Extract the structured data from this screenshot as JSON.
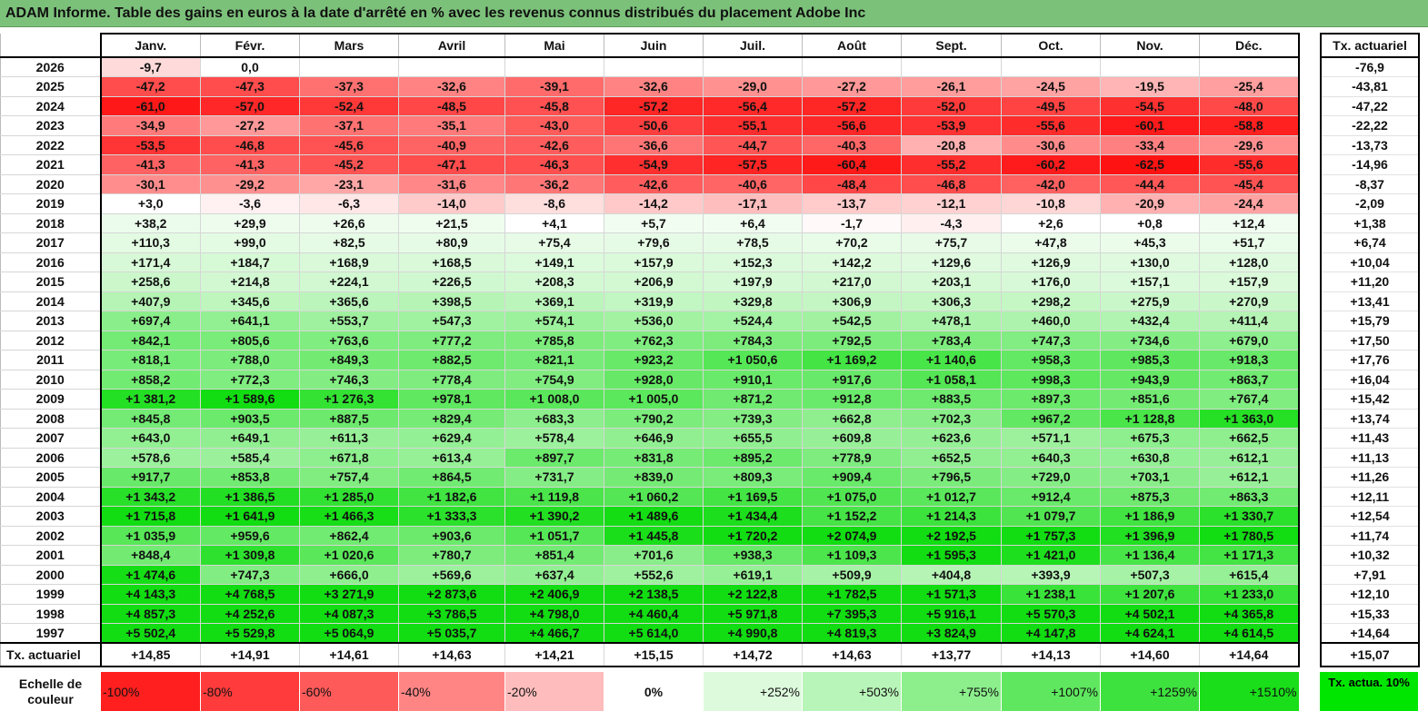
{
  "title": "ADAM Informe. Table des gains en euros à la date d'arrêté en % avec les revenus connus distribués du placement Adobe Inc",
  "months": [
    "Janv.",
    "Févr.",
    "Mars",
    "Avril",
    "Mai",
    "Juin",
    "Juil.",
    "Août",
    "Sept.",
    "Oct.",
    "Nov.",
    "Déc."
  ],
  "side_header": "Tx. actuariel",
  "rows": [
    {
      "year": "2026",
      "cells": [
        "-9,7",
        "0,0",
        "",
        "",
        "",
        "",
        "",
        "",
        "",
        "",
        "",
        ""
      ],
      "rate": "-76,9"
    },
    {
      "year": "2025",
      "cells": [
        "-47,2",
        "-47,3",
        "-37,3",
        "-32,6",
        "-39,1",
        "-32,6",
        "-29,0",
        "-27,2",
        "-26,1",
        "-24,5",
        "-19,5",
        "-25,4"
      ],
      "rate": "-43,81"
    },
    {
      "year": "2024",
      "cells": [
        "-61,0",
        "-57,0",
        "-52,4",
        "-48,5",
        "-45,8",
        "-57,2",
        "-56,4",
        "-57,2",
        "-52,0",
        "-49,5",
        "-54,5",
        "-48,0"
      ],
      "rate": "-47,22"
    },
    {
      "year": "2023",
      "cells": [
        "-34,9",
        "-27,2",
        "-37,1",
        "-35,1",
        "-43,0",
        "-50,6",
        "-55,1",
        "-56,6",
        "-53,9",
        "-55,6",
        "-60,1",
        "-58,8"
      ],
      "rate": "-22,22"
    },
    {
      "year": "2022",
      "cells": [
        "-53,5",
        "-46,8",
        "-45,6",
        "-40,9",
        "-42,6",
        "-36,6",
        "-44,7",
        "-40,3",
        "-20,8",
        "-30,6",
        "-33,4",
        "-29,6"
      ],
      "rate": "-13,73"
    },
    {
      "year": "2021",
      "cells": [
        "-41,3",
        "-41,3",
        "-45,2",
        "-47,1",
        "-46,3",
        "-54,9",
        "-57,5",
        "-60,4",
        "-55,2",
        "-60,2",
        "-62,5",
        "-55,6"
      ],
      "rate": "-14,96"
    },
    {
      "year": "2020",
      "cells": [
        "-30,1",
        "-29,2",
        "-23,1",
        "-31,6",
        "-36,2",
        "-42,6",
        "-40,6",
        "-48,4",
        "-46,8",
        "-42,0",
        "-44,4",
        "-45,4"
      ],
      "rate": "-8,37"
    },
    {
      "year": "2019",
      "cells": [
        "+3,0",
        "-3,6",
        "-6,3",
        "-14,0",
        "-8,6",
        "-14,2",
        "-17,1",
        "-13,7",
        "-12,1",
        "-10,8",
        "-20,9",
        "-24,4"
      ],
      "rate": "-2,09"
    },
    {
      "year": "2018",
      "cells": [
        "+38,2",
        "+29,9",
        "+26,6",
        "+21,5",
        "+4,1",
        "+5,7",
        "+6,4",
        "-1,7",
        "-4,3",
        "+2,6",
        "+0,8",
        "+12,4"
      ],
      "rate": "+1,38"
    },
    {
      "year": "2017",
      "cells": [
        "+110,3",
        "+99,0",
        "+82,5",
        "+80,9",
        "+75,4",
        "+79,6",
        "+78,5",
        "+70,2",
        "+75,7",
        "+47,8",
        "+45,3",
        "+51,7"
      ],
      "rate": "+6,74"
    },
    {
      "year": "2016",
      "cells": [
        "+171,4",
        "+184,7",
        "+168,9",
        "+168,5",
        "+149,1",
        "+157,9",
        "+152,3",
        "+142,2",
        "+129,6",
        "+126,9",
        "+130,0",
        "+128,0"
      ],
      "rate": "+10,04"
    },
    {
      "year": "2015",
      "cells": [
        "+258,6",
        "+214,8",
        "+224,1",
        "+226,5",
        "+208,3",
        "+206,9",
        "+197,9",
        "+217,0",
        "+203,1",
        "+176,0",
        "+157,1",
        "+157,9"
      ],
      "rate": "+11,20"
    },
    {
      "year": "2014",
      "cells": [
        "+407,9",
        "+345,6",
        "+365,6",
        "+398,5",
        "+369,1",
        "+319,9",
        "+329,8",
        "+306,9",
        "+306,3",
        "+298,2",
        "+275,9",
        "+270,9"
      ],
      "rate": "+13,41"
    },
    {
      "year": "2013",
      "cells": [
        "+697,4",
        "+641,1",
        "+553,7",
        "+547,3",
        "+574,1",
        "+536,0",
        "+524,4",
        "+542,5",
        "+478,1",
        "+460,0",
        "+432,4",
        "+411,4"
      ],
      "rate": "+15,79"
    },
    {
      "year": "2012",
      "cells": [
        "+842,1",
        "+805,6",
        "+763,6",
        "+777,2",
        "+785,8",
        "+762,3",
        "+784,3",
        "+792,5",
        "+783,4",
        "+747,3",
        "+734,6",
        "+679,0"
      ],
      "rate": "+17,50"
    },
    {
      "year": "2011",
      "cells": [
        "+818,1",
        "+788,0",
        "+849,3",
        "+882,5",
        "+821,1",
        "+923,2",
        "+1 050,6",
        "+1 169,2",
        "+1 140,6",
        "+958,3",
        "+985,3",
        "+918,3"
      ],
      "rate": "+17,76"
    },
    {
      "year": "2010",
      "cells": [
        "+858,2",
        "+772,3",
        "+746,3",
        "+778,4",
        "+754,9",
        "+928,0",
        "+910,1",
        "+917,6",
        "+1 058,1",
        "+998,3",
        "+943,9",
        "+863,7"
      ],
      "rate": "+16,04"
    },
    {
      "year": "2009",
      "cells": [
        "+1 381,2",
        "+1 589,6",
        "+1 276,3",
        "+978,1",
        "+1 008,0",
        "+1 005,0",
        "+871,2",
        "+912,8",
        "+883,5",
        "+897,3",
        "+851,6",
        "+767,4"
      ],
      "rate": "+15,42"
    },
    {
      "year": "2008",
      "cells": [
        "+845,8",
        "+903,5",
        "+887,5",
        "+829,4",
        "+683,3",
        "+790,2",
        "+739,3",
        "+662,8",
        "+702,3",
        "+967,2",
        "+1 128,8",
        "+1 363,0"
      ],
      "rate": "+13,74"
    },
    {
      "year": "2007",
      "cells": [
        "+643,0",
        "+649,1",
        "+611,3",
        "+629,4",
        "+578,4",
        "+646,9",
        "+655,5",
        "+609,8",
        "+623,6",
        "+571,1",
        "+675,3",
        "+662,5"
      ],
      "rate": "+11,43"
    },
    {
      "year": "2006",
      "cells": [
        "+578,6",
        "+585,4",
        "+671,8",
        "+613,4",
        "+897,7",
        "+831,8",
        "+895,2",
        "+778,9",
        "+652,5",
        "+640,3",
        "+630,8",
        "+612,1"
      ],
      "rate": "+11,13"
    },
    {
      "year": "2005",
      "cells": [
        "+917,7",
        "+853,8",
        "+757,4",
        "+864,5",
        "+731,7",
        "+839,0",
        "+809,3",
        "+909,4",
        "+796,5",
        "+729,0",
        "+703,1",
        "+612,1"
      ],
      "rate": "+11,26"
    },
    {
      "year": "2004",
      "cells": [
        "+1 343,2",
        "+1 386,5",
        "+1 285,0",
        "+1 182,6",
        "+1 119,8",
        "+1 060,2",
        "+1 169,5",
        "+1 075,0",
        "+1 012,7",
        "+912,4",
        "+875,3",
        "+863,3"
      ],
      "rate": "+12,11"
    },
    {
      "year": "2003",
      "cells": [
        "+1 715,8",
        "+1 641,9",
        "+1 466,3",
        "+1 333,3",
        "+1 390,2",
        "+1 489,6",
        "+1 434,4",
        "+1 152,2",
        "+1 214,3",
        "+1 079,7",
        "+1 186,9",
        "+1 330,7"
      ],
      "rate": "+12,54"
    },
    {
      "year": "2002",
      "cells": [
        "+1 035,9",
        "+959,6",
        "+862,4",
        "+903,6",
        "+1 051,7",
        "+1 445,8",
        "+1 720,2",
        "+2 074,9",
        "+2 192,5",
        "+1 757,3",
        "+1 396,9",
        "+1 780,5"
      ],
      "rate": "+11,74"
    },
    {
      "year": "2001",
      "cells": [
        "+848,4",
        "+1 309,8",
        "+1 020,6",
        "+780,7",
        "+851,4",
        "+701,6",
        "+938,3",
        "+1 109,3",
        "+1 595,3",
        "+1 421,0",
        "+1 136,4",
        "+1 171,3"
      ],
      "rate": "+10,32"
    },
    {
      "year": "2000",
      "cells": [
        "+1 474,6",
        "+747,3",
        "+666,0",
        "+569,6",
        "+637,4",
        "+552,6",
        "+619,1",
        "+509,9",
        "+404,8",
        "+393,9",
        "+507,3",
        "+615,4"
      ],
      "rate": "+7,91"
    },
    {
      "year": "1999",
      "cells": [
        "+4 143,3",
        "+4 768,5",
        "+3 271,9",
        "+2 873,6",
        "+2 406,9",
        "+2 138,5",
        "+2 122,8",
        "+1 782,5",
        "+1 571,3",
        "+1 238,1",
        "+1 207,6",
        "+1 233,0"
      ],
      "rate": "+12,10"
    },
    {
      "year": "1998",
      "cells": [
        "+4 857,3",
        "+4 252,6",
        "+4 087,3",
        "+3 786,5",
        "+4 798,0",
        "+4 460,4",
        "+5 971,8",
        "+7 395,3",
        "+5 916,1",
        "+5 570,3",
        "+4 502,1",
        "+4 365,8"
      ],
      "rate": "+15,33"
    },
    {
      "year": "1997",
      "cells": [
        "+5 502,4",
        "+5 529,8",
        "+5 064,9",
        "+5 035,7",
        "+4 466,7",
        "+5 614,0",
        "+4 990,8",
        "+4 819,3",
        "+3 824,9",
        "+4 147,8",
        "+4 624,1",
        "+4 614,5"
      ],
      "rate": "+14,64"
    }
  ],
  "average_row": {
    "label": "Tx. actuariel",
    "cells": [
      "+14,85",
      "+14,91",
      "+14,61",
      "+14,63",
      "+14,21",
      "+15,15",
      "+14,72",
      "+14,63",
      "+13,77",
      "+14,13",
      "+14,60",
      "+14,64"
    ],
    "rate": "+15,07"
  },
  "scale": {
    "label": "Echelle de couleur",
    "steps": [
      {
        "text": "-100%",
        "color": "#ff1f1f"
      },
      {
        "text": "-80%",
        "color": "#ff3b3b"
      },
      {
        "text": "-60%",
        "color": "#ff5a5a"
      },
      {
        "text": "-40%",
        "color": "#ff8585"
      },
      {
        "text": "-20%",
        "color": "#ffbcbc"
      },
      {
        "text": "0%",
        "color": "#ffffff"
      },
      {
        "text": "+252%",
        "color": "#ddfadd"
      },
      {
        "text": "+503%",
        "color": "#b8f5b8"
      },
      {
        "text": "+755%",
        "color": "#8cef8c"
      },
      {
        "text": "+1007%",
        "color": "#5fe85f"
      },
      {
        "text": "+1259%",
        "color": "#3ee23e"
      },
      {
        "text": "+1510%",
        "color": "#19de19"
      }
    ],
    "legend_text": "Tx. actua. 10%",
    "legend_color": "#00e600"
  }
}
